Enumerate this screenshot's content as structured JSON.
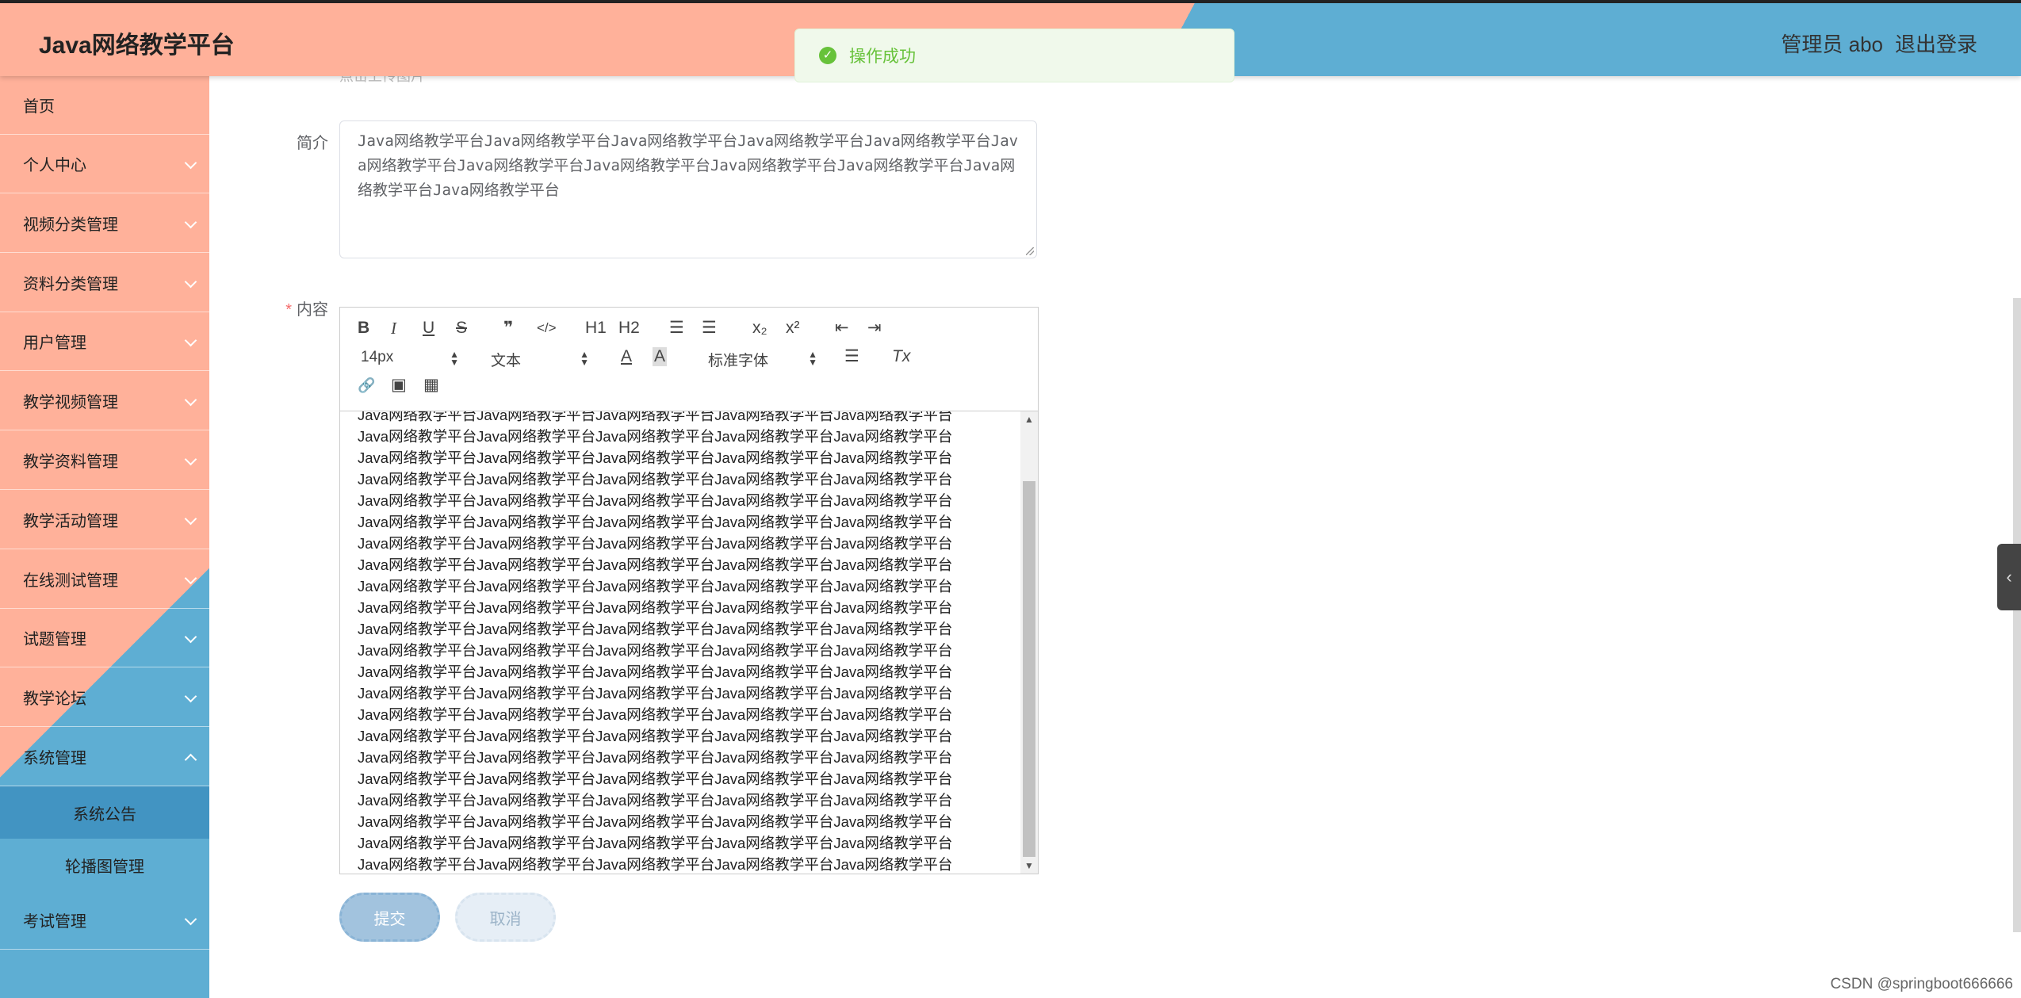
{
  "header": {
    "title": "Java网络教学平台",
    "user": "管理员 abo",
    "logout": "退出登录"
  },
  "toast": {
    "message": "操作成功"
  },
  "sidebar": {
    "items": [
      {
        "label": "首页"
      },
      {
        "label": "个人中心"
      },
      {
        "label": "视频分类管理"
      },
      {
        "label": "资料分类管理"
      },
      {
        "label": "用户管理"
      },
      {
        "label": "教学视频管理"
      },
      {
        "label": "教学资料管理"
      },
      {
        "label": "教学活动管理"
      },
      {
        "label": "在线测试管理"
      },
      {
        "label": "试题管理"
      },
      {
        "label": "教学论坛"
      },
      {
        "label": "系统管理"
      }
    ],
    "submenu": [
      {
        "label": "系统公告"
      },
      {
        "label": "轮播图管理"
      }
    ],
    "last_item": {
      "label": "考试管理"
    }
  },
  "form": {
    "upload_hint": "点击上传图片",
    "intro_label": "简介",
    "intro_value": "Java网络教学平台Java网络教学平台Java网络教学平台Java网络教学平台Java网络教学平台Java网络教学平台Java网络教学平台Java网络教学平台Java网络教学平台Java网络教学平台Java网络教学平台Java网络教学平台",
    "content_label": "内容",
    "required_mark": "*",
    "submit": "提交",
    "cancel": "取消"
  },
  "editor": {
    "toolbar": {
      "bold": "B",
      "italic": "I",
      "underline": "U",
      "strike": "S",
      "quote": "❞",
      "code": "</>",
      "h1": "H1",
      "h2": "H2",
      "ordered_list": "☰",
      "bullet_list": "☰",
      "subscript": "x₂",
      "superscript": "x²",
      "outdent": "⇤",
      "indent": "⇥",
      "font_size": "14px",
      "paragraph": "文本",
      "font_color": "A",
      "bg_color": "A",
      "font_family": "标准字体",
      "align": "☰",
      "clear_format": "Tx",
      "link": "🔗",
      "image": "▣",
      "video": "▦"
    },
    "content_line": "Java网络教学平台Java网络教学平台Java网络教学平台Java网络教学平台Java网络教学平台",
    "line_count": 22
  },
  "watermark": "CSDN @springboot666666",
  "colors": {
    "salmon": "#ffb19a",
    "blue": "#5eaed3",
    "success": "#67c23a"
  }
}
